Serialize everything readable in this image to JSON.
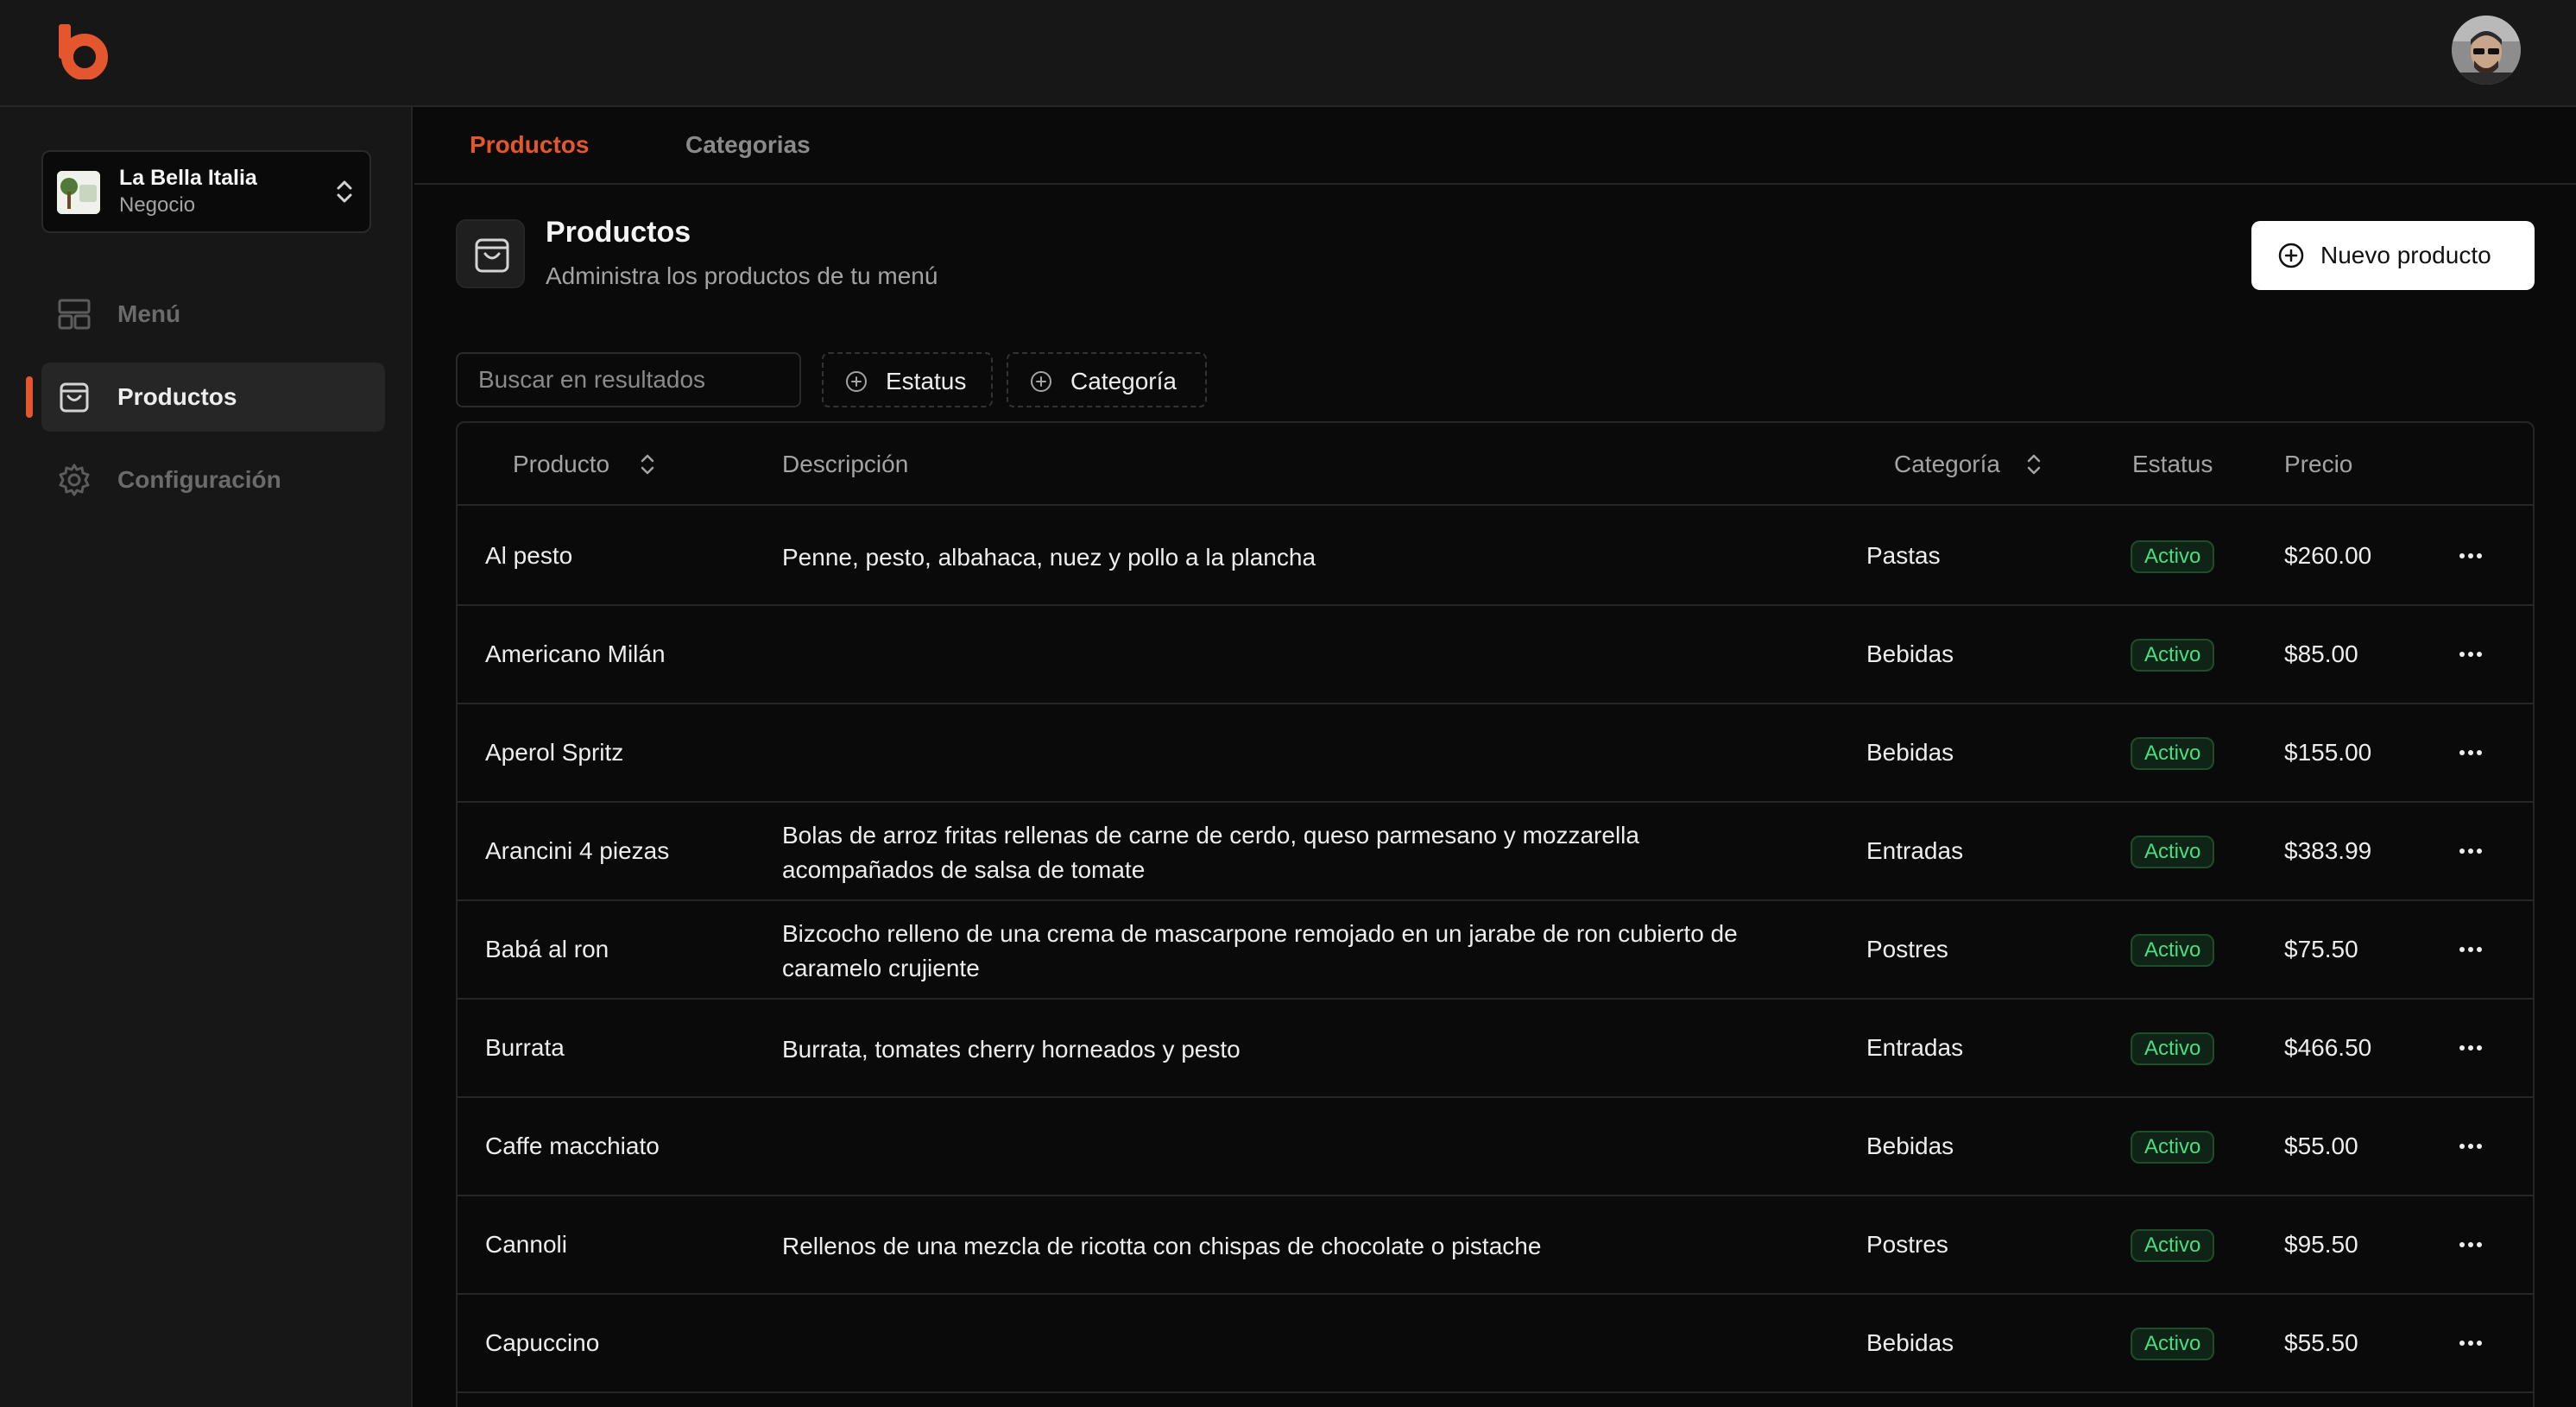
{
  "brand": {
    "logo_icon": "b-logo-icon",
    "accent": "#e4572e"
  },
  "user": {
    "avatar_icon": "user-avatar"
  },
  "business": {
    "name": "La Bella Italia",
    "type": "Negocio"
  },
  "sidebar": {
    "items": [
      {
        "label": "Menú",
        "icon": "layout-icon",
        "active": false
      },
      {
        "label": "Productos",
        "icon": "shopping-bag-icon",
        "active": true
      },
      {
        "label": "Configuración",
        "icon": "gear-icon",
        "active": false
      }
    ]
  },
  "tabs": [
    {
      "label": "Productos",
      "active": true
    },
    {
      "label": "Categorias",
      "active": false
    }
  ],
  "header": {
    "title": "Productos",
    "subtitle": "Administra los productos de tu menú",
    "new_button": "Nuevo producto"
  },
  "filters": {
    "search_placeholder": "Buscar en resultados",
    "status_label": "Estatus",
    "category_label": "Categoría"
  },
  "table": {
    "columns": [
      "Producto",
      "Descripción",
      "Categoría",
      "Estatus",
      "Precio"
    ],
    "rows": [
      {
        "name": "Al pesto",
        "desc1": "Penne, pesto, albahaca, nuez y pollo a la plancha",
        "desc2": "",
        "category": "Pastas",
        "status": "Activo",
        "price": "$260.00"
      },
      {
        "name": "Americano Milán",
        "desc1": "",
        "desc2": "",
        "category": "Bebidas",
        "status": "Activo",
        "price": "$85.00"
      },
      {
        "name": "Aperol Spritz",
        "desc1": "",
        "desc2": "",
        "category": "Bebidas",
        "status": "Activo",
        "price": "$155.00"
      },
      {
        "name": "Arancini 4 piezas",
        "desc1": "Bolas de arroz fritas rellenas de carne de cerdo, queso parmesano y mozzarella",
        "desc2": "acompañados de salsa de tomate",
        "category": "Entradas",
        "status": "Activo",
        "price": "$383.99"
      },
      {
        "name": "Babá al ron",
        "desc1": "Bizcocho relleno de una crema de mascarpone remojado en un jarabe de ron cubierto de",
        "desc2": "caramelo crujiente",
        "category": "Postres",
        "status": "Activo",
        "price": "$75.50"
      },
      {
        "name": "Burrata",
        "desc1": "Burrata, tomates cherry horneados y pesto",
        "desc2": "",
        "category": "Entradas",
        "status": "Activo",
        "price": "$466.50"
      },
      {
        "name": "Caffe macchiato",
        "desc1": "",
        "desc2": "",
        "category": "Bebidas",
        "status": "Activo",
        "price": "$55.00"
      },
      {
        "name": "Cannoli",
        "desc1": "Rellenos de una mezcla de ricotta con chispas de chocolate o pistache",
        "desc2": "",
        "category": "Postres",
        "status": "Activo",
        "price": "$95.50"
      },
      {
        "name": "Capuccino",
        "desc1": "",
        "desc2": "",
        "category": "Bebidas",
        "status": "Activo",
        "price": "$55.50"
      }
    ]
  }
}
